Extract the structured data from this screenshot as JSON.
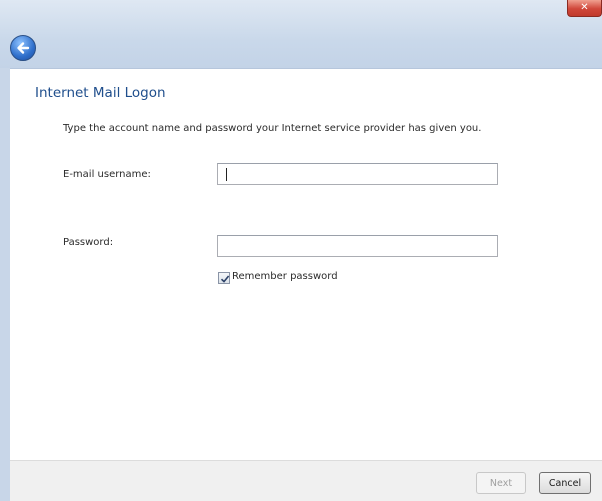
{
  "window": {
    "close_label": "✕"
  },
  "page": {
    "heading": "Internet Mail Logon",
    "description": "Type the account name and password your Internet service provider has given you."
  },
  "form": {
    "username": {
      "label": "E-mail username:",
      "value": ""
    },
    "password": {
      "label": "Password:",
      "value": ""
    },
    "remember_password": {
      "label": "Remember password",
      "checked": true
    }
  },
  "footer": {
    "next_label": "Next",
    "cancel_label": "Cancel"
  },
  "icons": {
    "back": "back-arrow-icon",
    "close": "close-icon",
    "check": "checkmark-icon"
  },
  "colors": {
    "heading": "#1f4e8c",
    "titlebar": "#c9d8ea",
    "close": "#d0473a"
  }
}
